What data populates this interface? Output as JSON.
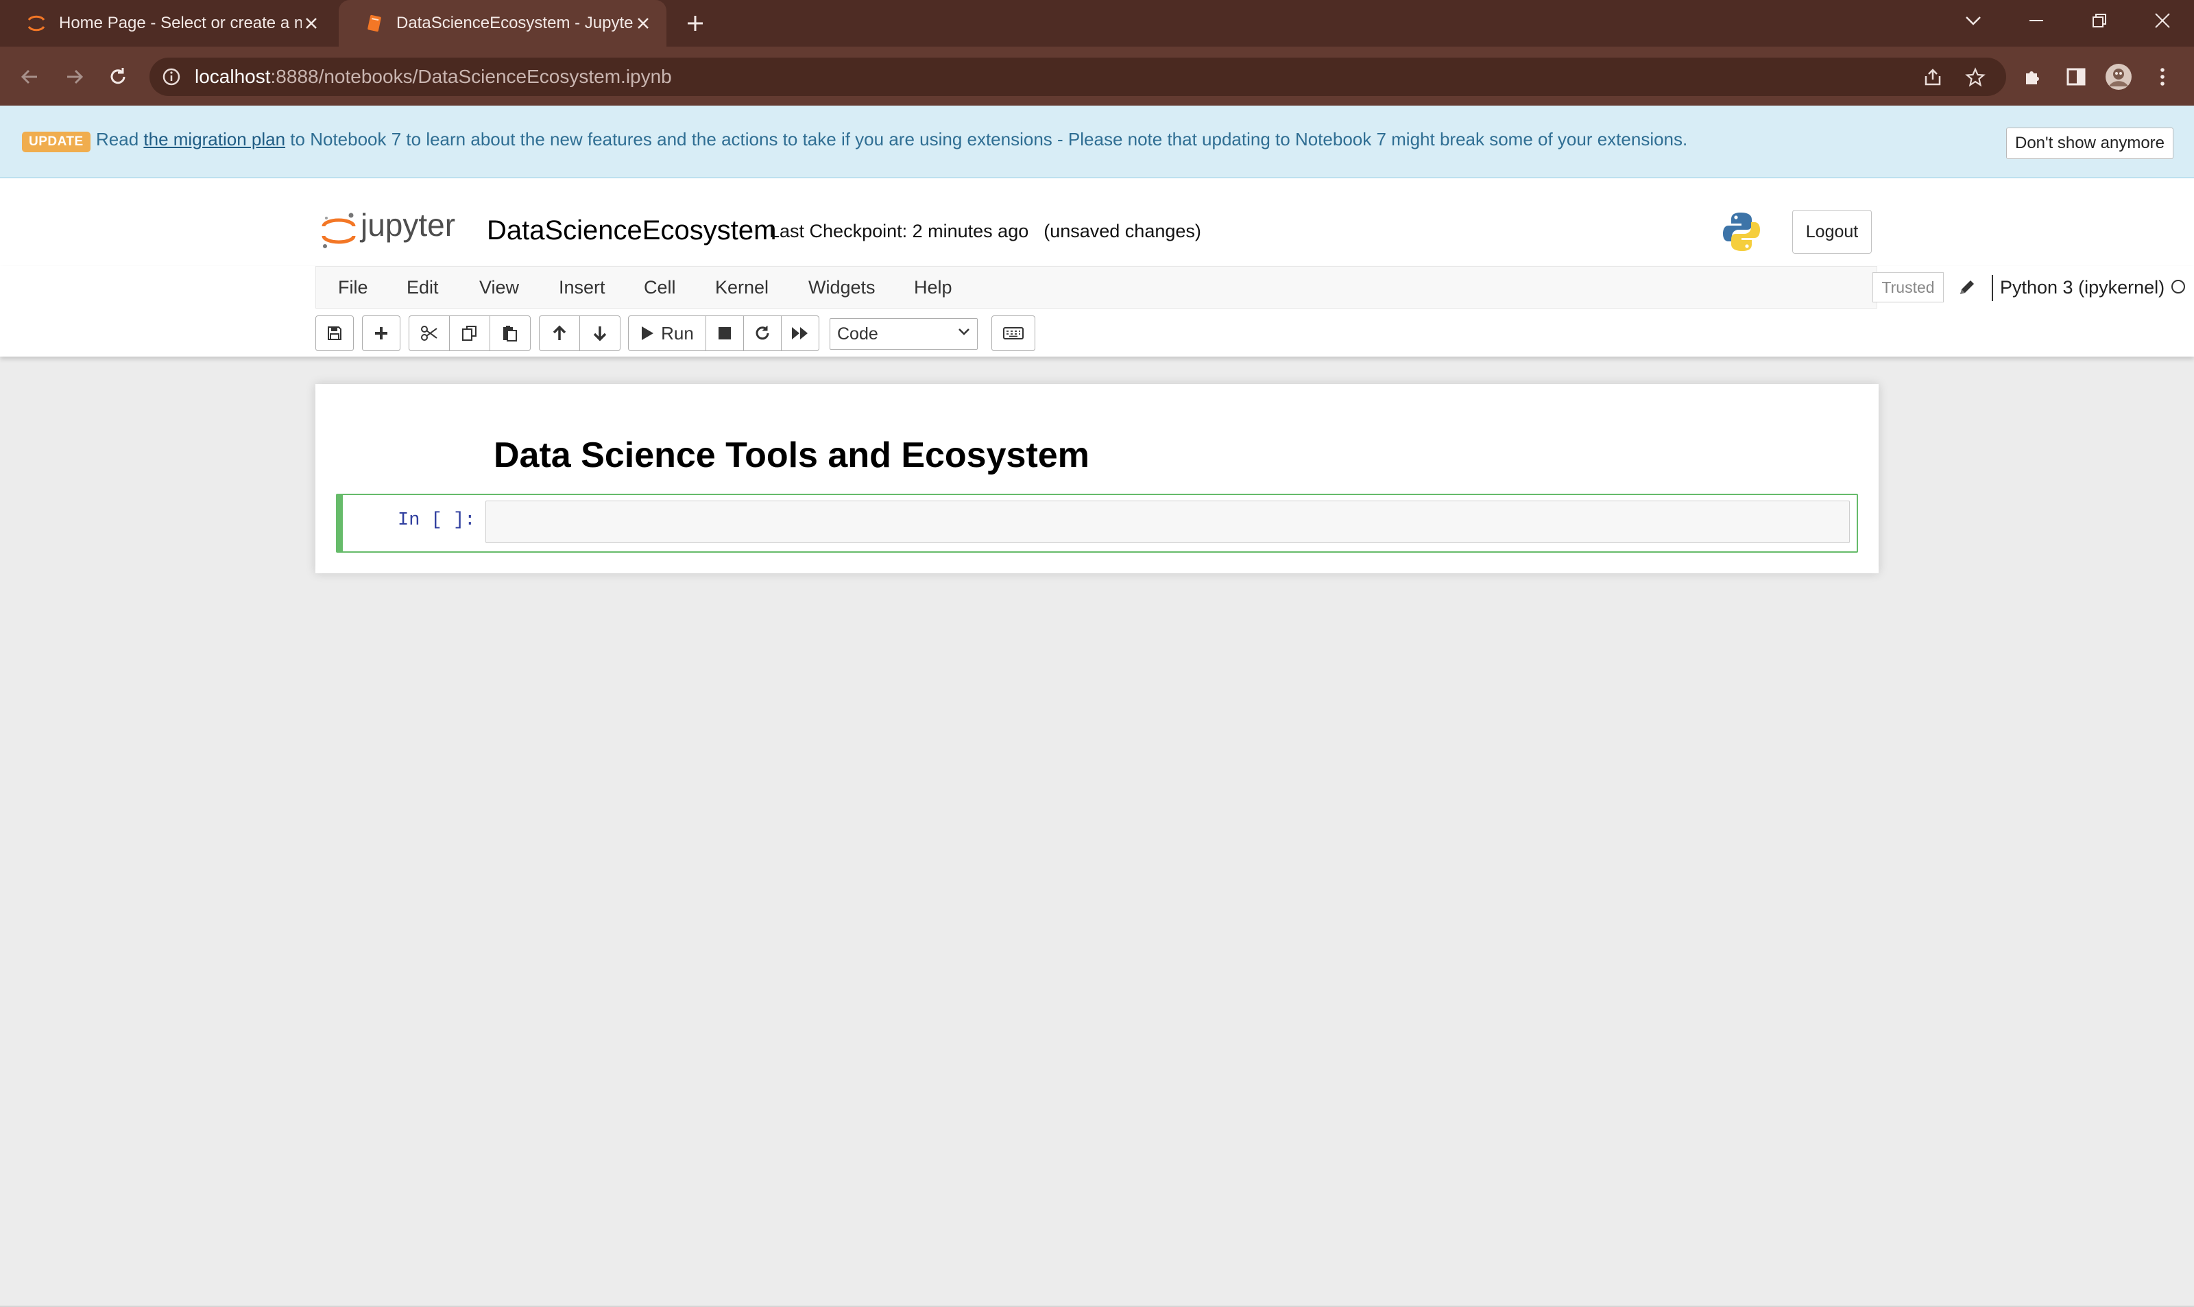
{
  "browser": {
    "tabs": [
      {
        "title": "Home Page - Select or create a notebook",
        "active": false
      },
      {
        "title": "DataScienceEcosystem - Jupyter Notebook",
        "active": true
      }
    ],
    "url_host": "localhost",
    "url_rest": ":8888/notebooks/DataScienceEcosystem.ipynb"
  },
  "banner": {
    "badge": "UPDATE",
    "text_before": "Read ",
    "link_text": "the migration plan",
    "text_after": " to Notebook 7 to learn about the new features and the actions to take if you are using extensions - Please note that updating to Notebook 7 might break some of your extensions.",
    "dismiss_label": "Don't show anymore"
  },
  "header": {
    "notebook_name": "DataScienceEcosystem",
    "checkpoint": "Last Checkpoint: 2 minutes ago",
    "unsaved": "(unsaved changes)",
    "logout_label": "Logout"
  },
  "menu": {
    "items": [
      "File",
      "Edit",
      "View",
      "Insert",
      "Cell",
      "Kernel",
      "Widgets",
      "Help"
    ],
    "trusted_label": "Trusted",
    "kernel_name": "Python 3 (ipykernel)"
  },
  "toolbar": {
    "run_label": "Run",
    "cell_type": "Code"
  },
  "notebook": {
    "heading": "Data Science Tools and Ecosystem",
    "cells": [
      {
        "prompt": "In [ ]:",
        "source": ""
      }
    ]
  },
  "colors": {
    "tabbar": "#4e2c24",
    "addressbar": "#633b31",
    "banner_bg": "#d8edf6",
    "badge": "#f0ad4e",
    "selected_cell": "#66bb6a",
    "prompt": "#303f9f",
    "jupyter_orange": "#f37726"
  }
}
